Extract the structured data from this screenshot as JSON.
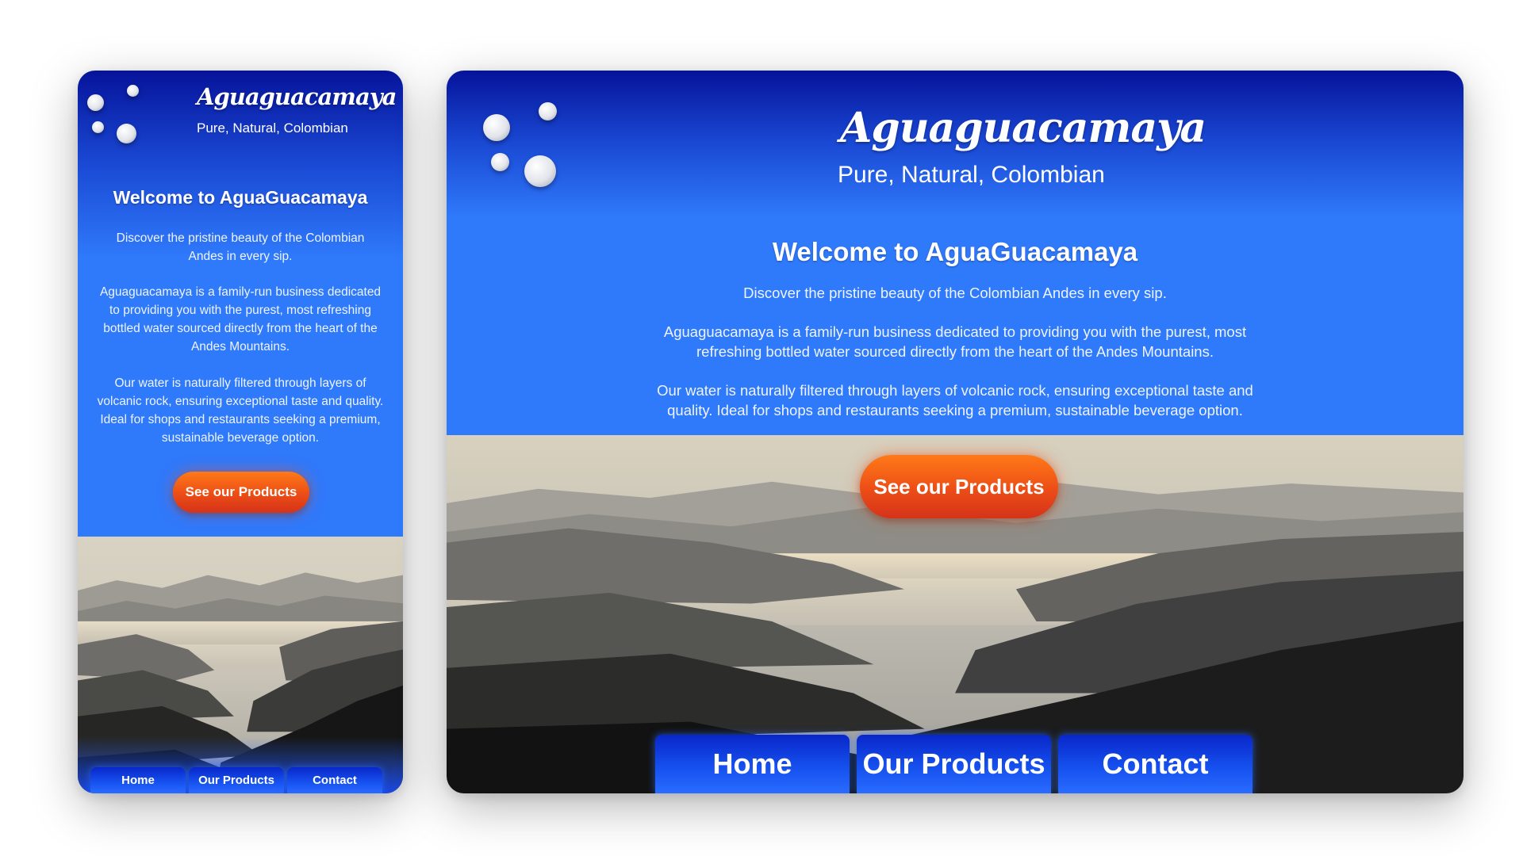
{
  "mobile": {
    "brand": "Aguaguacamaya",
    "tagline": "Pure, Natural, Colombian",
    "welcome_title": "Welcome to AguaGuacamaya",
    "paragraphs": [
      "Discover the pristine beauty of the Colombian Andes in every sip.",
      "Aguaguacamaya is a family-run business dedicated to providing you with the purest, most refreshing bottled water sourced directly from the heart of the Andes Mountains.",
      "Our water is naturally filtered through layers of volcanic rock, ensuring exceptional taste and quality. Ideal for shops and restaurants seeking a premium, sustainable beverage option."
    ],
    "cta_label": "See our Products",
    "nav": [
      "Home",
      "Our Products",
      "Contact"
    ]
  },
  "desktop": {
    "brand": "Aguaguacamaya",
    "tagline": "Pure, Natural, Colombian",
    "welcome_title": "Welcome to AguaGuacamaya",
    "paragraphs": [
      "Discover the pristine beauty of the Colombian Andes in every sip.",
      "Aguaguacamaya is a family-run business dedicated to providing you with the purest, most refreshing bottled water sourced directly from the heart of the Andes Mountains.",
      "Our water is naturally filtered through layers of volcanic rock, ensuring exceptional taste and quality. Ideal for shops and restaurants seeking a premium, sustainable beverage option."
    ],
    "cta_label": "See our Products",
    "nav": [
      "Home",
      "Our Products",
      "Contact"
    ]
  },
  "colors": {
    "hero_top": "#06139a",
    "hero_blue": "#2f79fb",
    "cta_orange": "#ec4d16",
    "nav_blue": "#1550ee"
  },
  "icons": {
    "decoration": "water-bubbles-icon"
  }
}
